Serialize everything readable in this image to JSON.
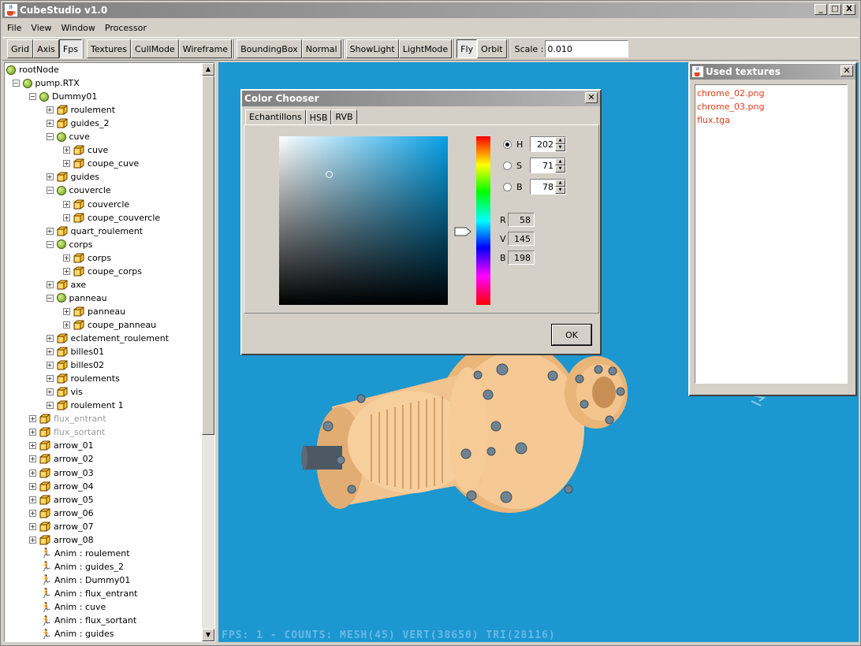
{
  "app": {
    "title": "CubeStudio v1.0",
    "window_buttons": [
      "_",
      "□",
      "X"
    ]
  },
  "menu": [
    "File",
    "View",
    "Window",
    "Processor"
  ],
  "toolbar": {
    "groups": [
      [
        {
          "label": "Grid"
        },
        {
          "label": "Axis"
        },
        {
          "label": "Fps",
          "active": true
        }
      ],
      [
        {
          "label": "Textures"
        },
        {
          "label": "CullMode"
        },
        {
          "label": "Wireframe"
        }
      ],
      [
        {
          "label": "BoundingBox"
        },
        {
          "label": "Normal"
        }
      ],
      [
        {
          "label": "ShowLight"
        },
        {
          "label": "LightMode"
        }
      ],
      [
        {
          "label": "Fly",
          "active": true
        },
        {
          "label": "Orbit"
        }
      ]
    ],
    "scale_label": "Scale :",
    "scale_value": "0.010"
  },
  "tree": {
    "items": [
      {
        "label": "rootNode",
        "icon": "ball",
        "depth": 0,
        "expander": ""
      },
      {
        "label": "pump.RTX",
        "icon": "ball",
        "depth": 1,
        "expander": "-"
      },
      {
        "label": "Dummy01",
        "icon": "ball",
        "depth": 2,
        "expander": "-"
      },
      {
        "label": "roulement",
        "icon": "cube",
        "depth": 3,
        "expander": "+"
      },
      {
        "label": "guides_2",
        "icon": "cube",
        "depth": 3,
        "expander": "+"
      },
      {
        "label": "cuve",
        "icon": "ball",
        "depth": 3,
        "expander": "-"
      },
      {
        "label": "cuve",
        "icon": "cube",
        "depth": 4,
        "expander": "+"
      },
      {
        "label": "coupe_cuve",
        "icon": "cube",
        "depth": 4,
        "expander": "+"
      },
      {
        "label": "guides",
        "icon": "cube",
        "depth": 3,
        "expander": "+"
      },
      {
        "label": "couvercle",
        "icon": "ball",
        "depth": 3,
        "expander": "-"
      },
      {
        "label": "couvercle",
        "icon": "cube",
        "depth": 4,
        "expander": "+"
      },
      {
        "label": "coupe_couvercle",
        "icon": "cube",
        "depth": 4,
        "expander": "+"
      },
      {
        "label": "quart_roulement",
        "icon": "cube",
        "depth": 3,
        "expander": "+"
      },
      {
        "label": "corps",
        "icon": "ball",
        "depth": 3,
        "expander": "-"
      },
      {
        "label": "corps",
        "icon": "cube",
        "depth": 4,
        "expander": "+"
      },
      {
        "label": "coupe_corps",
        "icon": "cube",
        "depth": 4,
        "expander": "+"
      },
      {
        "label": "axe",
        "icon": "cube",
        "depth": 3,
        "expander": "+"
      },
      {
        "label": "panneau",
        "icon": "ball",
        "depth": 3,
        "expander": "-"
      },
      {
        "label": "panneau",
        "icon": "cube",
        "depth": 4,
        "expander": "+"
      },
      {
        "label": "coupe_panneau",
        "icon": "cube",
        "depth": 4,
        "expander": "+"
      },
      {
        "label": "eclatement_roulement",
        "icon": "cube",
        "depth": 3,
        "expander": "+"
      },
      {
        "label": "billes01",
        "icon": "cube",
        "depth": 3,
        "expander": "+"
      },
      {
        "label": "billes02",
        "icon": "cube",
        "depth": 3,
        "expander": "+"
      },
      {
        "label": "roulements",
        "icon": "cube",
        "depth": 3,
        "expander": "+"
      },
      {
        "label": "vis",
        "icon": "cube",
        "depth": 3,
        "expander": "+"
      },
      {
        "label": "roulement 1",
        "icon": "cube",
        "depth": 3,
        "expander": "+"
      },
      {
        "label": "flux_entrant",
        "icon": "cube",
        "depth": 2,
        "expander": "+",
        "dim": true
      },
      {
        "label": "flux_sortant",
        "icon": "cube",
        "depth": 2,
        "expander": "+",
        "dim": true
      },
      {
        "label": "arrow_01",
        "icon": "cube",
        "depth": 2,
        "expander": "+"
      },
      {
        "label": "arrow_02",
        "icon": "cube",
        "depth": 2,
        "expander": "+"
      },
      {
        "label": "arrow_03",
        "icon": "cube",
        "depth": 2,
        "expander": "+"
      },
      {
        "label": "arrow_04",
        "icon": "cube",
        "depth": 2,
        "expander": "+"
      },
      {
        "label": "arrow_05",
        "icon": "cube",
        "depth": 2,
        "expander": "+"
      },
      {
        "label": "arrow_06",
        "icon": "cube",
        "depth": 2,
        "expander": "+"
      },
      {
        "label": "arrow_07",
        "icon": "cube",
        "depth": 2,
        "expander": "+"
      },
      {
        "label": "arrow_08",
        "icon": "cube",
        "depth": 2,
        "expander": "+"
      },
      {
        "label": "Anim : roulement",
        "icon": "runner",
        "depth": 2,
        "expander": ""
      },
      {
        "label": "Anim : guides_2",
        "icon": "runner",
        "depth": 2,
        "expander": ""
      },
      {
        "label": "Anim : Dummy01",
        "icon": "runner",
        "depth": 2,
        "expander": ""
      },
      {
        "label": "Anim : flux_entrant",
        "icon": "runner",
        "depth": 2,
        "expander": ""
      },
      {
        "label": "Anim : cuve",
        "icon": "runner",
        "depth": 2,
        "expander": ""
      },
      {
        "label": "Anim : flux_sortant",
        "icon": "runner",
        "depth": 2,
        "expander": ""
      },
      {
        "label": "Anim : guides",
        "icon": "runner",
        "depth": 2,
        "expander": ""
      }
    ]
  },
  "viewport": {
    "background": "#1c97cf",
    "status": "FPS: 1 - COUNTS: MESH(45) VERT(38650) TRI(28116)"
  },
  "color_chooser": {
    "title": "Color Chooser",
    "tabs": [
      {
        "label": "Echantillons",
        "active": false
      },
      {
        "label": "HSB",
        "active": true
      },
      {
        "label": "RVB",
        "active": false
      }
    ],
    "hsb": [
      {
        "label": "H",
        "value": "202",
        "selected": true
      },
      {
        "label": "S",
        "value": "71",
        "selected": false
      },
      {
        "label": "B",
        "value": "78",
        "selected": false
      }
    ],
    "rgb": [
      {
        "label": "R",
        "value": "58"
      },
      {
        "label": "V",
        "value": "145"
      },
      {
        "label": "B",
        "value": "198"
      }
    ],
    "ok_label": "OK"
  },
  "used_textures": {
    "title": "Used textures",
    "items": [
      "chrome_02.png",
      "chrome_03.png",
      "flux.tga"
    ]
  }
}
